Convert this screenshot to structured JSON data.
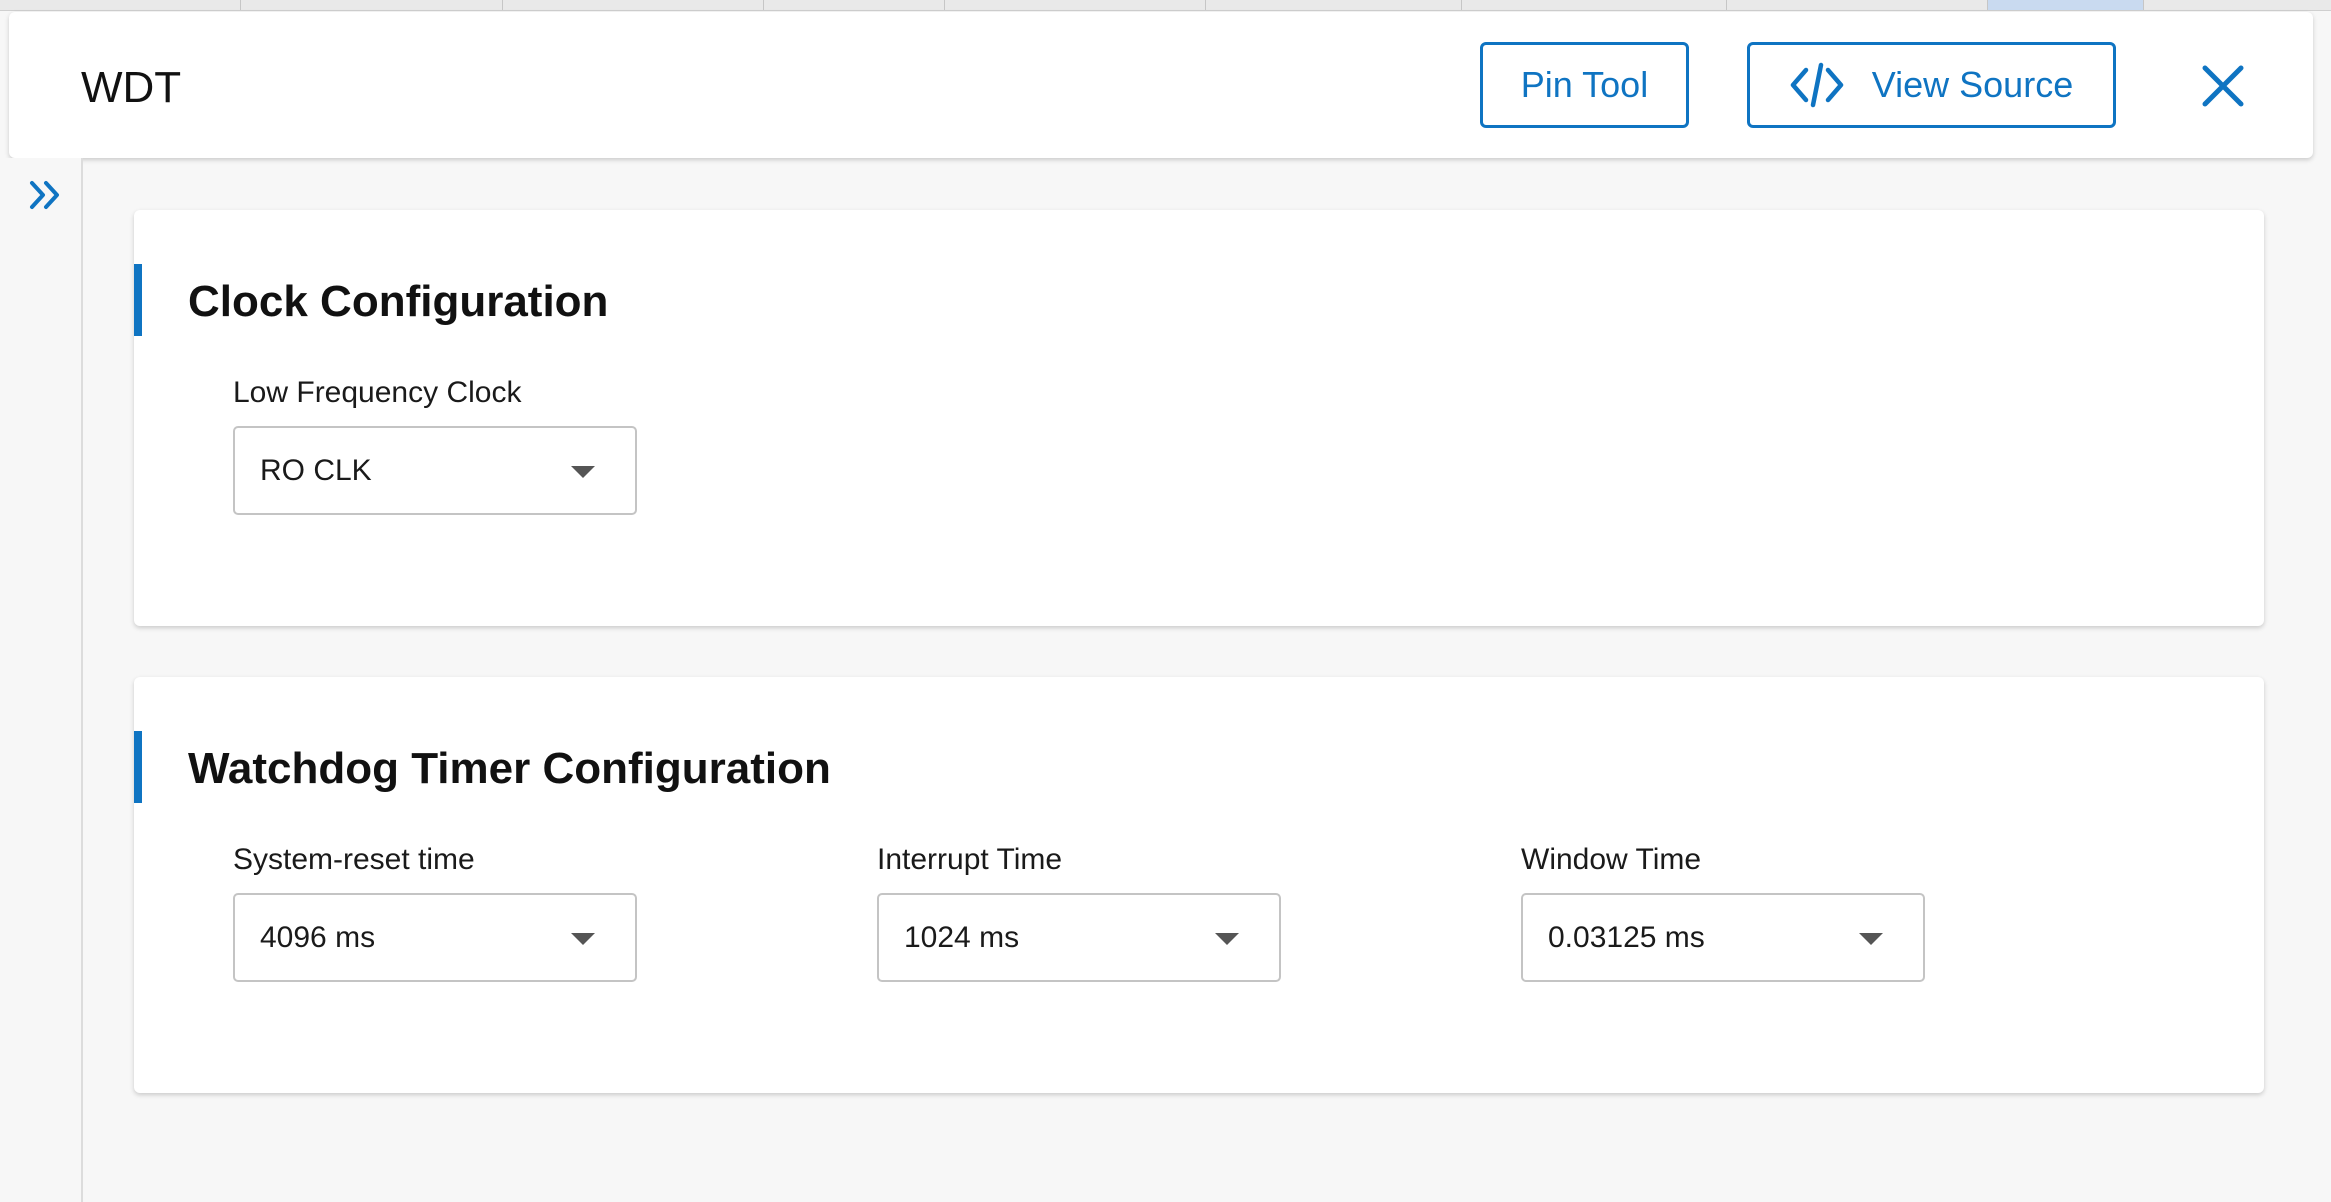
{
  "header": {
    "title": "WDT",
    "pin_tool_label": "Pin Tool",
    "view_source_label": "View Source"
  },
  "colors": {
    "accent": "#0f74c2",
    "background": "#f7f7f7",
    "card": "#ffffff"
  },
  "icons": {
    "view_source": "code-icon",
    "close": "close-icon",
    "expand": "double-chevron-right-icon"
  },
  "sections": {
    "clock": {
      "title": "Clock Configuration",
      "fields": [
        {
          "label": "Low Frequency Clock",
          "value": "RO CLK"
        }
      ]
    },
    "watchdog": {
      "title": "Watchdog Timer Configuration",
      "fields": [
        {
          "label": "System-reset time",
          "value": "4096 ms"
        },
        {
          "label": "Interrupt Time",
          "value": "1024 ms"
        },
        {
          "label": "Window Time",
          "value": "0.03125 ms"
        }
      ]
    }
  }
}
